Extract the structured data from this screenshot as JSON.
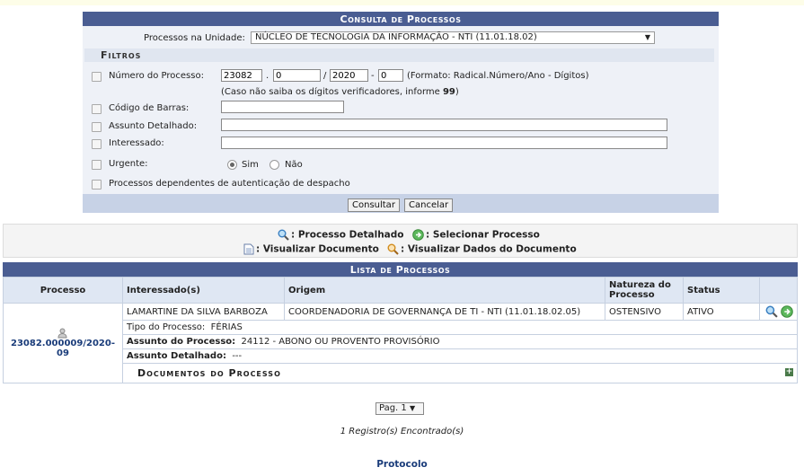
{
  "panel": {
    "title": "Consulta de Processos",
    "unit_label": "Processos na Unidade:",
    "unit_value": "NÚCLEO DE TECNOLOGIA DA INFORMAÇÃO - NTI (11.01.18.02)",
    "filters_title": "Filtros",
    "numero_label": "Número do Processo:",
    "numero_radical": "23082",
    "numero_numero": "0",
    "numero_ano": "2020",
    "numero_digitos": "0",
    "numero_hint": "(Formato: Radical.Número/Ano - Dígitos)",
    "numero_note_prefix": "(Caso não saiba os dígitos verificadores, informe ",
    "numero_note_bold": "99",
    "numero_note_suffix": ")",
    "codigo_label": "Código de Barras:",
    "assunto_label": "Assunto Detalhado:",
    "interessado_label": "Interessado:",
    "urgente_label": "Urgente:",
    "sim_label": "Sim",
    "nao_label": "Não",
    "dependentes_label": "Processos dependentes de autenticação de despacho",
    "consultar": "Consultar",
    "cancelar": "Cancelar"
  },
  "legend": {
    "detalhado": ": Processo Detalhado",
    "selecionar": ": Selecionar Processo",
    "visualizar_doc": ": Visualizar Documento",
    "visualizar_dados": ": Visualizar Dados do Documento"
  },
  "list": {
    "title": "Lista de Processos",
    "headers": [
      "Processo",
      "Interessado(s)",
      "Origem",
      "Natureza do Processo",
      "Status"
    ],
    "row": {
      "processo": "23082.000009/2020-09",
      "interessado": "LAMARTINE DA SILVA BARBOZA",
      "origem": "COORDENADORIA DE GOVERNANÇA DE TI - NTI (11.01.18.02.05)",
      "natureza": "OSTENSIVO",
      "status": "ATIVO",
      "tipo_label": "Tipo do Processo:",
      "tipo_value": "FÉRIAS",
      "assunto_label": "Assunto do Processo:",
      "assunto_value": "24112 - ABONO OU PROVENTO PROVISÓRIO",
      "detalhado_label": "Assunto Detalhado:",
      "detalhado_value": "---",
      "documentos": "Documentos do Processo"
    }
  },
  "pager": "Pag. 1",
  "found": "1 Registro(s) Encontrado(s)",
  "footer_link": "Protocolo"
}
